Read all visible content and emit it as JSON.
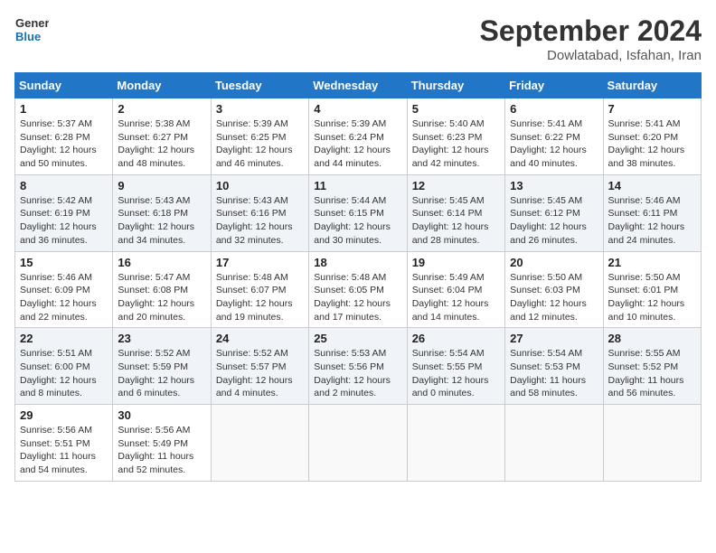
{
  "header": {
    "logo_line1": "General",
    "logo_line2": "Blue",
    "month": "September 2024",
    "location": "Dowlatabad, Isfahan, Iran"
  },
  "weekdays": [
    "Sunday",
    "Monday",
    "Tuesday",
    "Wednesday",
    "Thursday",
    "Friday",
    "Saturday"
  ],
  "weeks": [
    [
      {
        "day": "1",
        "sunrise": "Sunrise: 5:37 AM",
        "sunset": "Sunset: 6:28 PM",
        "daylight": "Daylight: 12 hours and 50 minutes."
      },
      {
        "day": "2",
        "sunrise": "Sunrise: 5:38 AM",
        "sunset": "Sunset: 6:27 PM",
        "daylight": "Daylight: 12 hours and 48 minutes."
      },
      {
        "day": "3",
        "sunrise": "Sunrise: 5:39 AM",
        "sunset": "Sunset: 6:25 PM",
        "daylight": "Daylight: 12 hours and 46 minutes."
      },
      {
        "day": "4",
        "sunrise": "Sunrise: 5:39 AM",
        "sunset": "Sunset: 6:24 PM",
        "daylight": "Daylight: 12 hours and 44 minutes."
      },
      {
        "day": "5",
        "sunrise": "Sunrise: 5:40 AM",
        "sunset": "Sunset: 6:23 PM",
        "daylight": "Daylight: 12 hours and 42 minutes."
      },
      {
        "day": "6",
        "sunrise": "Sunrise: 5:41 AM",
        "sunset": "Sunset: 6:22 PM",
        "daylight": "Daylight: 12 hours and 40 minutes."
      },
      {
        "day": "7",
        "sunrise": "Sunrise: 5:41 AM",
        "sunset": "Sunset: 6:20 PM",
        "daylight": "Daylight: 12 hours and 38 minutes."
      }
    ],
    [
      {
        "day": "8",
        "sunrise": "Sunrise: 5:42 AM",
        "sunset": "Sunset: 6:19 PM",
        "daylight": "Daylight: 12 hours and 36 minutes."
      },
      {
        "day": "9",
        "sunrise": "Sunrise: 5:43 AM",
        "sunset": "Sunset: 6:18 PM",
        "daylight": "Daylight: 12 hours and 34 minutes."
      },
      {
        "day": "10",
        "sunrise": "Sunrise: 5:43 AM",
        "sunset": "Sunset: 6:16 PM",
        "daylight": "Daylight: 12 hours and 32 minutes."
      },
      {
        "day": "11",
        "sunrise": "Sunrise: 5:44 AM",
        "sunset": "Sunset: 6:15 PM",
        "daylight": "Daylight: 12 hours and 30 minutes."
      },
      {
        "day": "12",
        "sunrise": "Sunrise: 5:45 AM",
        "sunset": "Sunset: 6:14 PM",
        "daylight": "Daylight: 12 hours and 28 minutes."
      },
      {
        "day": "13",
        "sunrise": "Sunrise: 5:45 AM",
        "sunset": "Sunset: 6:12 PM",
        "daylight": "Daylight: 12 hours and 26 minutes."
      },
      {
        "day": "14",
        "sunrise": "Sunrise: 5:46 AM",
        "sunset": "Sunset: 6:11 PM",
        "daylight": "Daylight: 12 hours and 24 minutes."
      }
    ],
    [
      {
        "day": "15",
        "sunrise": "Sunrise: 5:46 AM",
        "sunset": "Sunset: 6:09 PM",
        "daylight": "Daylight: 12 hours and 22 minutes."
      },
      {
        "day": "16",
        "sunrise": "Sunrise: 5:47 AM",
        "sunset": "Sunset: 6:08 PM",
        "daylight": "Daylight: 12 hours and 20 minutes."
      },
      {
        "day": "17",
        "sunrise": "Sunrise: 5:48 AM",
        "sunset": "Sunset: 6:07 PM",
        "daylight": "Daylight: 12 hours and 19 minutes."
      },
      {
        "day": "18",
        "sunrise": "Sunrise: 5:48 AM",
        "sunset": "Sunset: 6:05 PM",
        "daylight": "Daylight: 12 hours and 17 minutes."
      },
      {
        "day": "19",
        "sunrise": "Sunrise: 5:49 AM",
        "sunset": "Sunset: 6:04 PM",
        "daylight": "Daylight: 12 hours and 14 minutes."
      },
      {
        "day": "20",
        "sunrise": "Sunrise: 5:50 AM",
        "sunset": "Sunset: 6:03 PM",
        "daylight": "Daylight: 12 hours and 12 minutes."
      },
      {
        "day": "21",
        "sunrise": "Sunrise: 5:50 AM",
        "sunset": "Sunset: 6:01 PM",
        "daylight": "Daylight: 12 hours and 10 minutes."
      }
    ],
    [
      {
        "day": "22",
        "sunrise": "Sunrise: 5:51 AM",
        "sunset": "Sunset: 6:00 PM",
        "daylight": "Daylight: 12 hours and 8 minutes."
      },
      {
        "day": "23",
        "sunrise": "Sunrise: 5:52 AM",
        "sunset": "Sunset: 5:59 PM",
        "daylight": "Daylight: 12 hours and 6 minutes."
      },
      {
        "day": "24",
        "sunrise": "Sunrise: 5:52 AM",
        "sunset": "Sunset: 5:57 PM",
        "daylight": "Daylight: 12 hours and 4 minutes."
      },
      {
        "day": "25",
        "sunrise": "Sunrise: 5:53 AM",
        "sunset": "Sunset: 5:56 PM",
        "daylight": "Daylight: 12 hours and 2 minutes."
      },
      {
        "day": "26",
        "sunrise": "Sunrise: 5:54 AM",
        "sunset": "Sunset: 5:55 PM",
        "daylight": "Daylight: 12 hours and 0 minutes."
      },
      {
        "day": "27",
        "sunrise": "Sunrise: 5:54 AM",
        "sunset": "Sunset: 5:53 PM",
        "daylight": "Daylight: 11 hours and 58 minutes."
      },
      {
        "day": "28",
        "sunrise": "Sunrise: 5:55 AM",
        "sunset": "Sunset: 5:52 PM",
        "daylight": "Daylight: 11 hours and 56 minutes."
      }
    ],
    [
      {
        "day": "29",
        "sunrise": "Sunrise: 5:56 AM",
        "sunset": "Sunset: 5:51 PM",
        "daylight": "Daylight: 11 hours and 54 minutes."
      },
      {
        "day": "30",
        "sunrise": "Sunrise: 5:56 AM",
        "sunset": "Sunset: 5:49 PM",
        "daylight": "Daylight: 11 hours and 52 minutes."
      },
      null,
      null,
      null,
      null,
      null
    ]
  ]
}
